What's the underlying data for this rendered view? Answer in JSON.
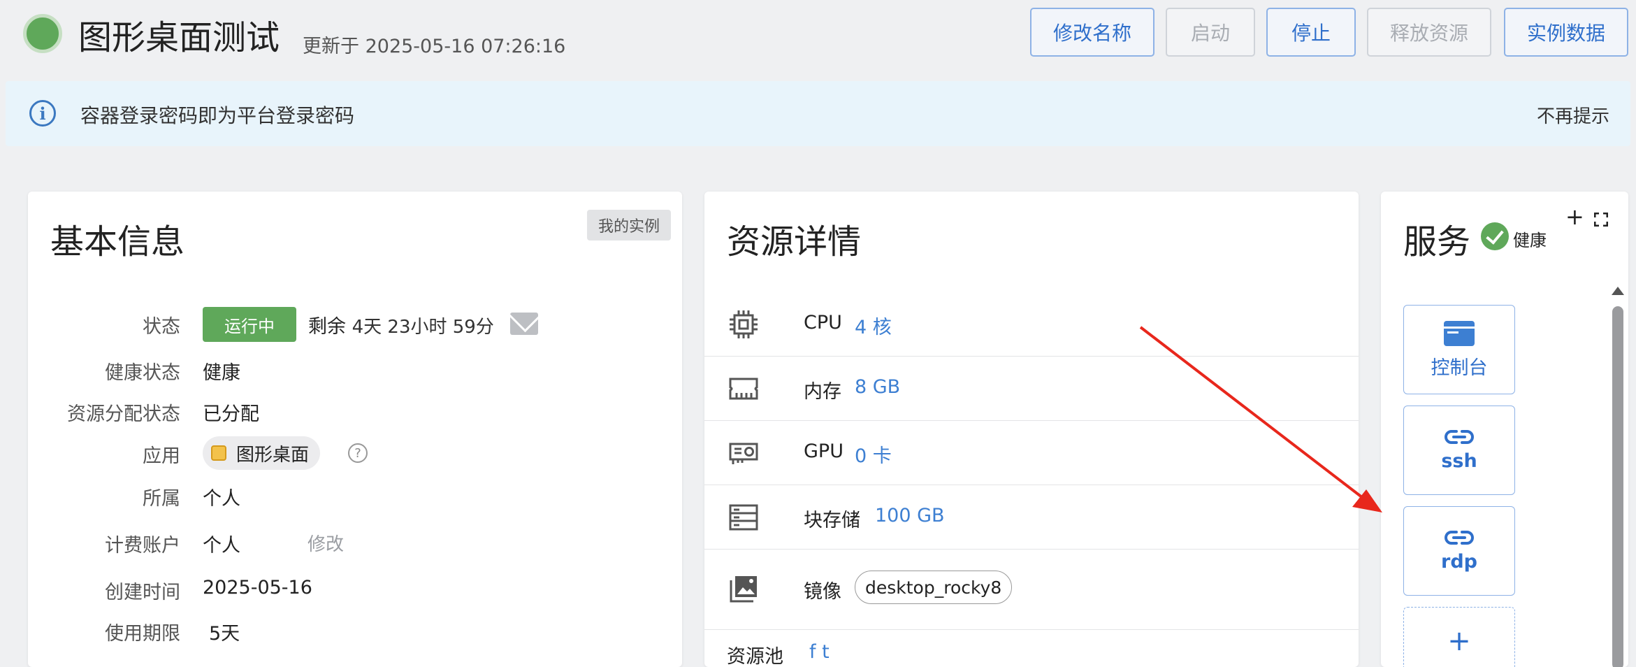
{
  "header": {
    "title": "图形桌面测试",
    "updated_at": "更新于 2025-05-16 07:26:16",
    "status_color": "#5fa85a",
    "buttons": {
      "rename": "修改名称",
      "start": "启动",
      "stop": "停止",
      "release": "释放资源",
      "instance_data": "实例数据"
    }
  },
  "notice": {
    "text": "容器登录密码即为平台登录密码",
    "dismiss": "不再提示",
    "icon": "info-icon"
  },
  "basic_info": {
    "title": "基本信息",
    "tag": "我的实例",
    "status": {
      "label": "状态",
      "badge": "运行中",
      "remaining_prefix": "剩余",
      "remaining": "4天 23小时 59分"
    },
    "health": {
      "label": "健康状态",
      "value": "健康"
    },
    "allocation": {
      "label": "资源分配状态",
      "value": "已分配"
    },
    "app": {
      "label": "应用",
      "value": "图形桌面"
    },
    "owner": {
      "label": "所属",
      "value": "个人"
    },
    "billing": {
      "label": "计费账户",
      "value": "个人",
      "edit": "修改"
    },
    "created": {
      "label": "创建时间",
      "value": "2025-05-16"
    },
    "period": {
      "label": "使用期限",
      "value": "5天"
    }
  },
  "resources": {
    "title": "资源详情",
    "items": [
      {
        "label": "CPU",
        "value": "4 核",
        "icon": "cpu-icon"
      },
      {
        "label": "内存",
        "value": "8 GB",
        "icon": "memory-icon"
      },
      {
        "label": "GPU",
        "value": "0 卡",
        "icon": "gpu-icon"
      },
      {
        "label": "块存储",
        "value": "100 GB",
        "icon": "storage-icon"
      }
    ],
    "image": {
      "label": "镜像",
      "value": "desktop_rocky8",
      "icon": "image-icon"
    },
    "pool": {
      "label": "资源池",
      "value": "f t"
    }
  },
  "services": {
    "title": "服务",
    "health": "健康",
    "tiles": [
      {
        "label": "控制台",
        "icon": "console-icon"
      },
      {
        "label": "ssh",
        "icon": "link-icon"
      },
      {
        "label": "rdp",
        "icon": "link-icon"
      }
    ],
    "add_tile_label": "+"
  },
  "colors": {
    "accent": "#2f6fcb",
    "success": "#5fa85a",
    "annotation": "#e8271c"
  }
}
